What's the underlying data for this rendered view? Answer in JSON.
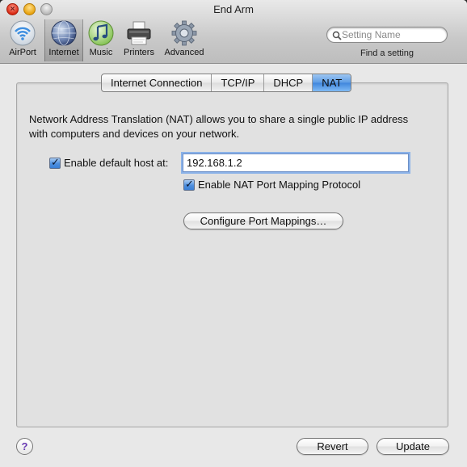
{
  "window": {
    "title": "End Arm"
  },
  "toolbar": {
    "items": [
      {
        "label": "AirPort",
        "icon": "airport-icon"
      },
      {
        "label": "Internet",
        "icon": "internet-globe-icon",
        "selected": true
      },
      {
        "label": "Music",
        "icon": "music-icon"
      },
      {
        "label": "Printers",
        "icon": "printer-icon"
      },
      {
        "label": "Advanced",
        "icon": "gear-icon"
      }
    ],
    "search": {
      "placeholder": "Setting Name",
      "value": "",
      "caption": "Find a setting"
    }
  },
  "tabs": [
    {
      "label": "Internet Connection",
      "active": false
    },
    {
      "label": "TCP/IP",
      "active": false
    },
    {
      "label": "DHCP",
      "active": false
    },
    {
      "label": "NAT",
      "active": true
    }
  ],
  "nat": {
    "description": "Network Address Translation (NAT) allows you to share a single public IP address with computers and devices on your network.",
    "default_host": {
      "label": "Enable default host at:",
      "checked": true,
      "value": "192.168.1.2"
    },
    "nat_pmp": {
      "label": "Enable NAT Port Mapping Protocol",
      "checked": true
    },
    "configure_button": "Configure Port Mappings…"
  },
  "footer": {
    "help": "?",
    "revert": "Revert",
    "update": "Update"
  },
  "colors": {
    "accent": "#3f86dc",
    "window_bg": "#e8e8e8",
    "panel_bg": "#e1e1e1"
  }
}
